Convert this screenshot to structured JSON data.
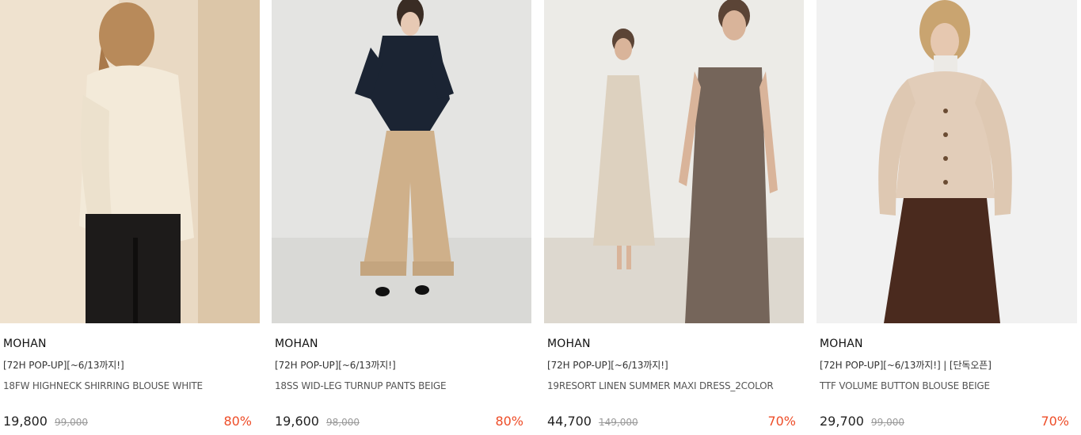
{
  "products": [
    {
      "brand": "MOHAN",
      "tag": "[72H POP-UP][~6/13까지!]",
      "name": "18FW HIGHNECK SHIRRING BLOUSE WHITE",
      "price": "19,800",
      "original_price": "99,000",
      "discount": "80%"
    },
    {
      "brand": "MOHAN",
      "tag": "[72H POP-UP][~6/13까지!]",
      "name": "18SS WID-LEG TURNUP PANTS BEIGE",
      "price": "19,600",
      "original_price": "98,000",
      "discount": "80%"
    },
    {
      "brand": "MOHAN",
      "tag": "[72H POP-UP][~6/13까지!]",
      "name": "19RESORT LINEN SUMMER MAXI DRESS_2COLOR",
      "price": "44,700",
      "original_price": "149,000",
      "discount": "70%"
    },
    {
      "brand": "MOHAN",
      "tag": "[72H POP-UP][~6/13까지!] | [단독오픈]",
      "name": "TTF VOLUME BUTTON BLOUSE BEIGE",
      "price": "29,700",
      "original_price": "99,000",
      "discount": "70%"
    }
  ],
  "colors": {
    "discount": "#ee4d28",
    "price": "#222222",
    "original_price": "#999999"
  }
}
